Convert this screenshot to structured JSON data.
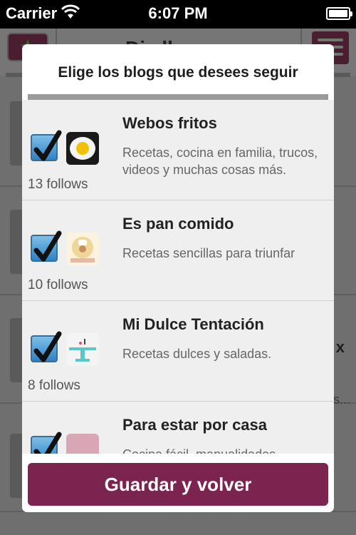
{
  "status_bar": {
    "carrier": "Carrier",
    "time": "6:07 PM"
  },
  "background_app": {
    "title_fragment": "Di...ll",
    "row_fragment": "x",
    "ellipsis": "s..."
  },
  "modal": {
    "title": "Elige los blogs que desees seguir",
    "blogs": [
      {
        "name": "Webos fritos",
        "description": "Recetas, cocina en familia, trucos, videos y muchas cosas más.",
        "follows": "13 follows",
        "checked": true,
        "thumb": "fried-egg-icon"
      },
      {
        "name": "Es pan comido",
        "description": "Recetas sencillas para triunfar",
        "follows": "10 follows",
        "checked": true,
        "thumb": "chef-logo-icon"
      },
      {
        "name": "Mi Dulce Tentación",
        "description": "Recetas dulces y saladas.",
        "follows": "8 follows",
        "checked": true,
        "thumb": "cake-stand-icon"
      },
      {
        "name": "Para estar por casa",
        "description": "Cocina fácil, manualidades",
        "follows": "",
        "checked": true,
        "thumb": "pink-photo-icon"
      }
    ],
    "save_label": "Guardar y volver"
  },
  "colors": {
    "accent": "#7b2450",
    "checkbox": "#2c82c7"
  }
}
